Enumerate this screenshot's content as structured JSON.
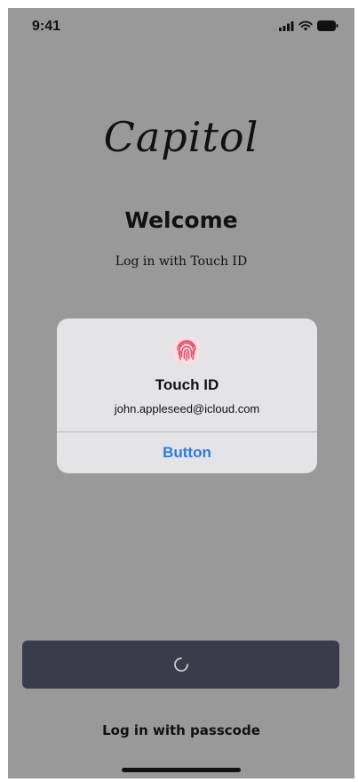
{
  "status_bar": {
    "time": "9:41"
  },
  "brand": {
    "logo_text": "Capitol"
  },
  "welcome": {
    "title": "Welcome",
    "subtitle": "Log in with Touch ID"
  },
  "touch_id_alert": {
    "icon": "fingerprint-icon",
    "title": "Touch ID",
    "email": "john.appleseed@icloud.com",
    "button_label": "Button",
    "accent_color": "#2a7be0"
  },
  "login_button": {
    "state": "loading",
    "icon": "spinner-icon",
    "background": "#3a3c4b"
  },
  "footer": {
    "passcode_link": "Log in with passcode"
  },
  "colors": {
    "screen_overlay": "#999999",
    "fingerprint": "#e8526b"
  }
}
